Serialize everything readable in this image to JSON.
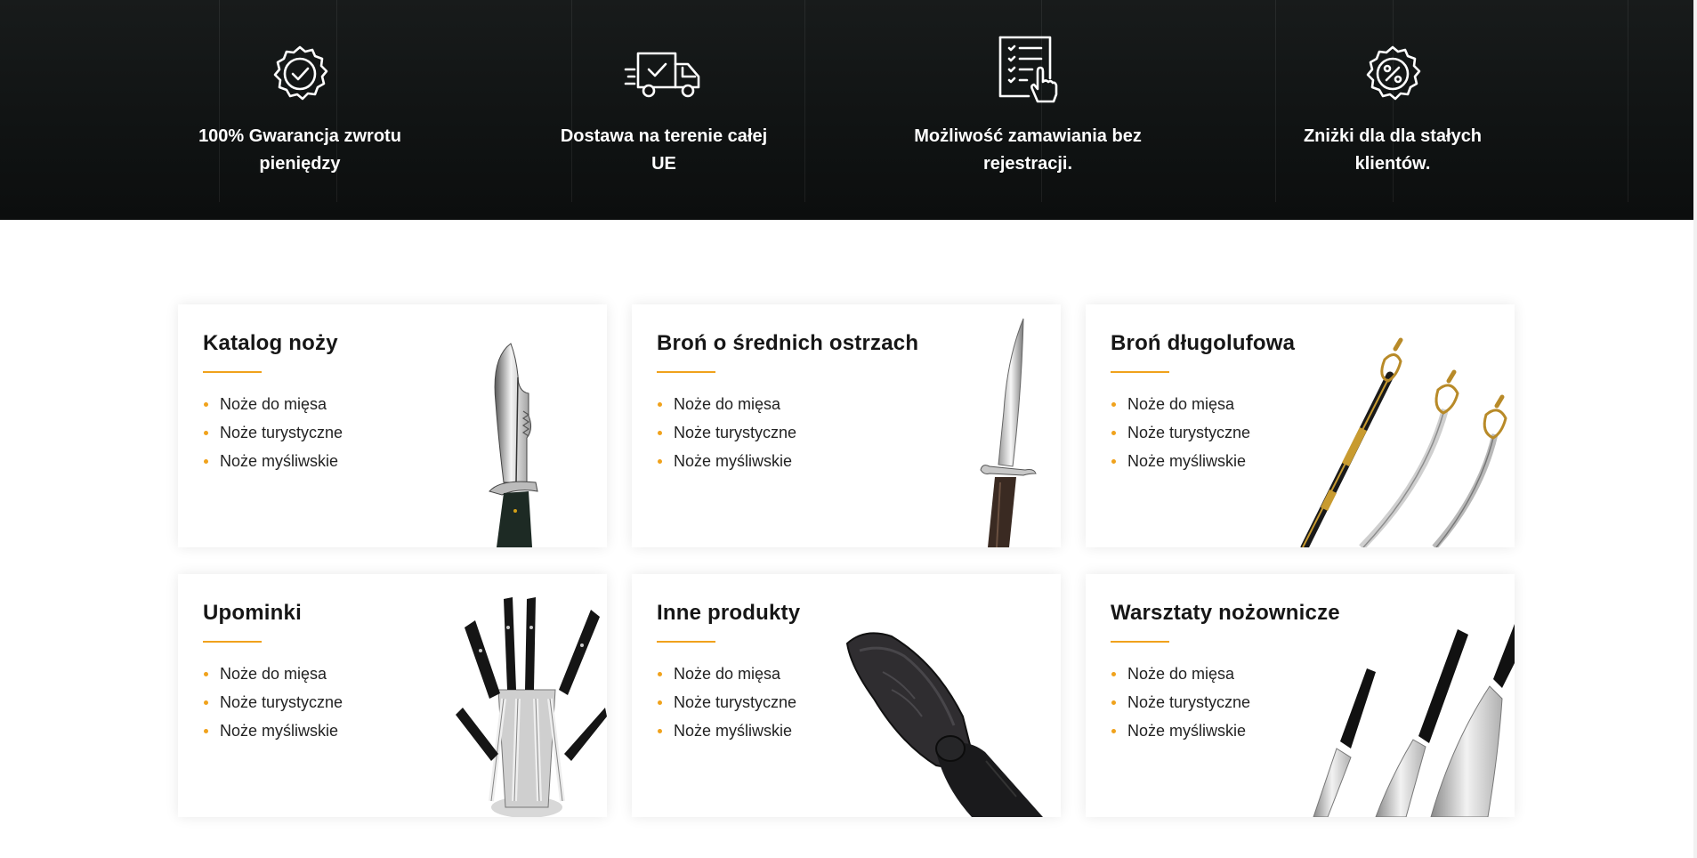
{
  "features": [
    {
      "icon": "guarantee-badge-icon",
      "text": "100% Gwarancja zwrotu pieniędzy"
    },
    {
      "icon": "delivery-truck-icon",
      "text": "Dostawa na terenie całej UE"
    },
    {
      "icon": "checklist-order-icon",
      "text": "Możliwość zamawiania bez rejestracji."
    },
    {
      "icon": "discount-percent-icon",
      "text": "Zniżki dla dla stałych klientów."
    }
  ],
  "accent_color": "#f0a21c",
  "categories": [
    {
      "title": "Katalog noży",
      "image": "hunting-knife-image",
      "items": [
        "Noże do mięsa",
        "Noże turystyczne",
        "Noże myśliwskie"
      ]
    },
    {
      "title": "Broń o średnich ostrzach",
      "image": "dagger-image",
      "items": [
        "Noże do mięsa",
        "Noże turystyczne",
        "Noże myśliwskie"
      ]
    },
    {
      "title": "Broń długolufowa",
      "image": "sabres-image",
      "items": [
        "Noże do mięsa",
        "Noże turystyczne",
        "Noże myśliwskie"
      ]
    },
    {
      "title": "Upominki",
      "image": "knife-block-set-image",
      "items": [
        "Noże do mięsa",
        "Noże turystyczne",
        "Noże myśliwskie"
      ]
    },
    {
      "title": "Inne produkty",
      "image": "leather-sheath-image",
      "items": [
        "Noże do mięsa",
        "Noże turystyczne",
        "Noże myśliwskie"
      ]
    },
    {
      "title": "Warsztaty nożownicze",
      "image": "kitchen-knives-image",
      "items": [
        "Noże do mięsa",
        "Noże turystyczne",
        "Noże myśliwskie"
      ]
    }
  ]
}
